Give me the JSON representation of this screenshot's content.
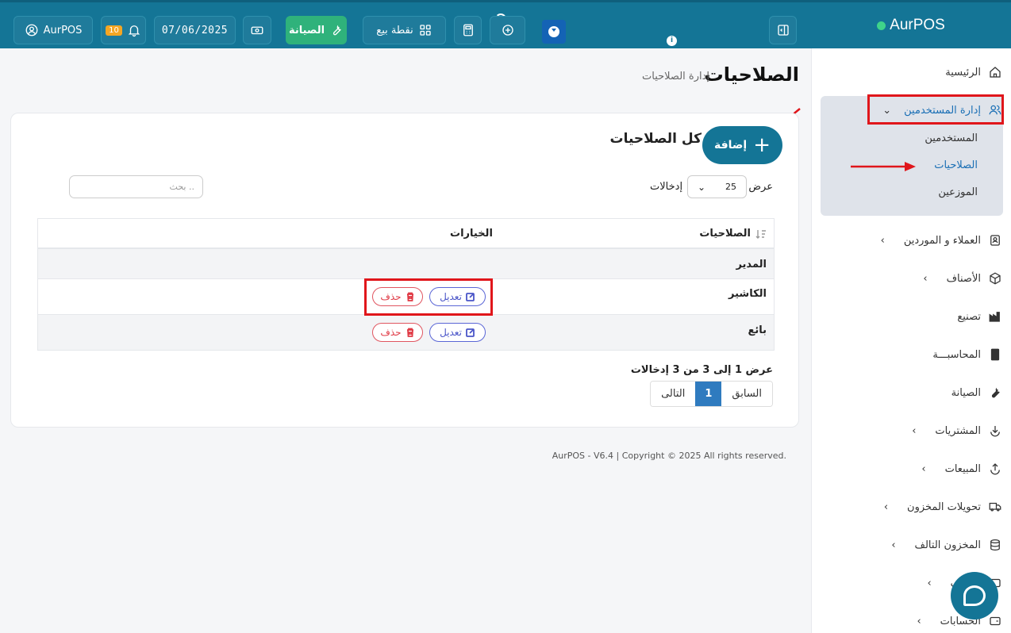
{
  "app": {
    "brand": "AurPOS"
  },
  "topbar": {
    "user_label": "AurPOS",
    "notif_count": "10",
    "date": "07/06/2025",
    "maintenance_label": "الصيانة",
    "pos_label": "نقطة بيع",
    "colors": {
      "bar": "#147596",
      "maintenance": "#2fb27b",
      "badge": "#f5a623"
    }
  },
  "sidebar": {
    "items": [
      {
        "label": "الرئيسية",
        "icon": "home-icon"
      },
      {
        "label": "إدارة المستخدمين",
        "icon": "users-icon"
      },
      {
        "label": "العملاء و الموردين",
        "icon": "contacts-icon"
      },
      {
        "label": "الأصناف",
        "icon": "box-icon"
      },
      {
        "label": "تصنيع",
        "icon": "factory-icon"
      },
      {
        "label": "المحاسبـــة",
        "icon": "book-icon"
      },
      {
        "label": "الصيانة",
        "icon": "wrench-icon"
      },
      {
        "label": "المشتريات",
        "icon": "download-icon"
      },
      {
        "label": "المبيعات",
        "icon": "upload-icon"
      },
      {
        "label": "تحويلات المخزون",
        "icon": "truck-icon"
      },
      {
        "label": "المخزون التالف",
        "icon": "database-icon"
      },
      {
        "label": "صاريف",
        "icon": "expense-icon"
      },
      {
        "label": "الحسابات",
        "icon": "wallet-icon"
      }
    ],
    "submenu": [
      "المستخدمين",
      "الصلاحيات",
      "الموزعين"
    ]
  },
  "page": {
    "title": "الصلاحيات",
    "breadcrumb": "إدارة الصلاحيات"
  },
  "card": {
    "title": "كل الصلاحيات",
    "add_label": "إضافة",
    "show_label": "عرض",
    "entries_label": "إدخالات",
    "page_length": "25",
    "search_placeholder": "بحث ..",
    "columns": {
      "name": "الصلاحيات",
      "options": "الخيارات"
    },
    "rows": [
      {
        "name": "المدير"
      },
      {
        "name": "الكاشير",
        "edit": "تعديل",
        "delete": "حذف"
      },
      {
        "name": "بائع",
        "edit": "تعديل",
        "delete": "حذف"
      }
    ],
    "info": "عرض 1 إلى 3 من 3 إدخالات",
    "pager": {
      "prev": "السابق",
      "current": "1",
      "next": "التالى"
    }
  },
  "footer": {
    "text": "AurPOS - V6.4 | Copyright © 2025 All rights reserved."
  }
}
